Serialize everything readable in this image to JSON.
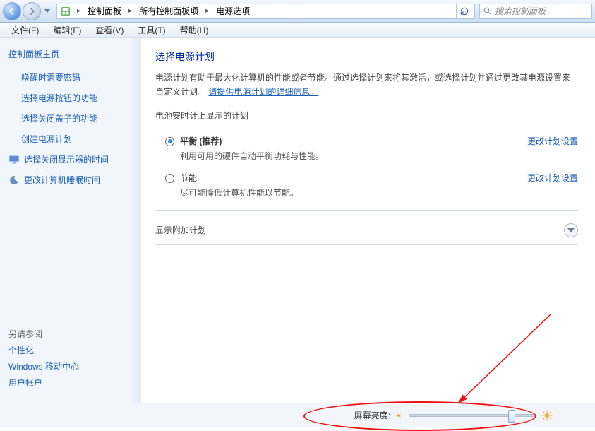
{
  "nav": {
    "breadcrumb": [
      "控制面板",
      "所有控制面板项",
      "电源选项"
    ],
    "search_placeholder": "搜索控制面板"
  },
  "menubar": [
    "文件(F)",
    "编辑(E)",
    "查看(V)",
    "工具(T)",
    "帮助(H)"
  ],
  "sidebar": {
    "home": "控制面板主页",
    "links": [
      "唤醒时需要密码",
      "选择电源按钮的功能",
      "选择关闭盖子的功能",
      "创建电源计划"
    ],
    "icon_links": [
      {
        "icon": "monitor",
        "label": "选择关闭显示器的时间"
      },
      {
        "icon": "moon",
        "label": "更改计算机睡眠时间"
      }
    ],
    "see_also_title": "另请参阅",
    "see_also": [
      "个性化",
      "Windows 移动中心",
      "用户帐户"
    ]
  },
  "main": {
    "heading": "选择电源计划",
    "desc_before": "电源计划有助于最大化计算机的性能或者节能。通过选择计划来将其激活，或选择计划并通过更改其电源设置来自定义计划。",
    "desc_link": "请提供电源计划的详细信息。",
    "group_title": "电池安时计上显示的计划",
    "plans": [
      {
        "checked": true,
        "name": "平衡 (推荐)",
        "desc": "利用可用的硬件自动平衡功耗与性能。",
        "edit": "更改计划设置"
      },
      {
        "checked": false,
        "name": "节能",
        "desc": "尽可能降低计算机性能以节能。",
        "edit": "更改计划设置"
      }
    ],
    "more_plans": "显示附加计划"
  },
  "footer": {
    "brightness_label": "屏幕亮度:"
  }
}
